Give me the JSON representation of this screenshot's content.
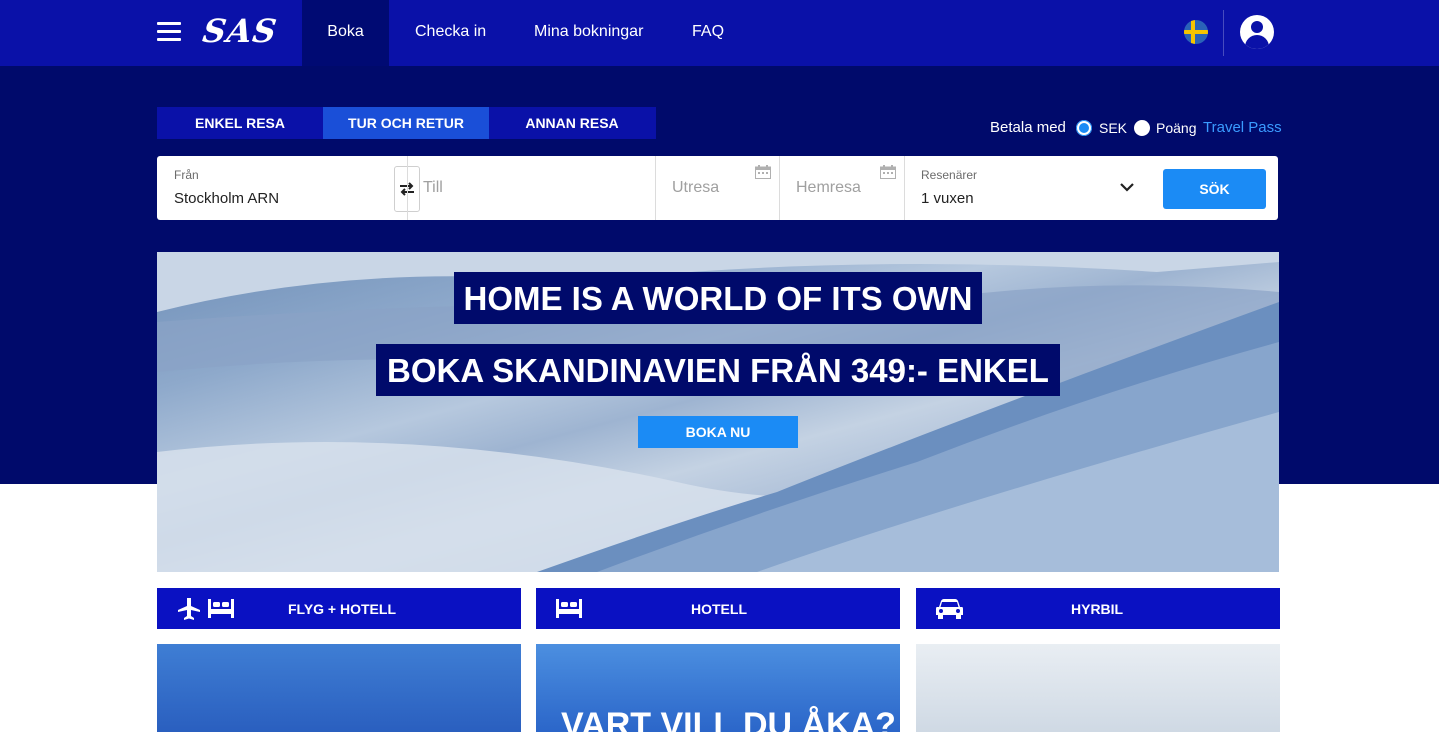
{
  "nav": {
    "logo": "SAS",
    "items": [
      {
        "label": "Boka"
      },
      {
        "label": "Checka in"
      },
      {
        "label": "Mina bokningar"
      },
      {
        "label": "FAQ"
      }
    ]
  },
  "trip_types": [
    "ENKEL RESA",
    "TUR OCH RETUR",
    "ANNAN RESA"
  ],
  "payment": {
    "label": "Betala med",
    "options": [
      "SEK",
      "Poäng"
    ],
    "selected": "SEK",
    "travel_pass": "Travel Pass"
  },
  "search": {
    "from_label": "Från",
    "from_value": "Stockholm ARN",
    "to_placeholder": "Till",
    "depart_placeholder": "Utresa",
    "return_placeholder": "Hemresa",
    "travelers_label": "Resenärer",
    "travelers_value": "1 vuxen",
    "button": "SÖK"
  },
  "banner": {
    "line1": "HOME IS A WORLD OF ITS OWN",
    "line2": "BOKA SKANDINAVIEN FRÅN 349:- ENKEL",
    "button": "BOKA NU"
  },
  "products": [
    {
      "label": "FLYG + HOTELL",
      "icons": [
        "plane-icon",
        "bed-icon"
      ]
    },
    {
      "label": "HOTELL",
      "icons": [
        "bed-icon"
      ]
    },
    {
      "label": "HYRBIL",
      "icons": [
        "car-icon"
      ]
    }
  ],
  "cards": [
    {
      "text": ""
    },
    {
      "text": "VART VILL DU ÅKA?"
    },
    {
      "text": ""
    }
  ],
  "colors": {
    "nav_blue": "#0a11a8",
    "dark_navy": "#000a6b",
    "accent_blue": "#1b8bf5",
    "product_blue": "#0a11c2"
  }
}
